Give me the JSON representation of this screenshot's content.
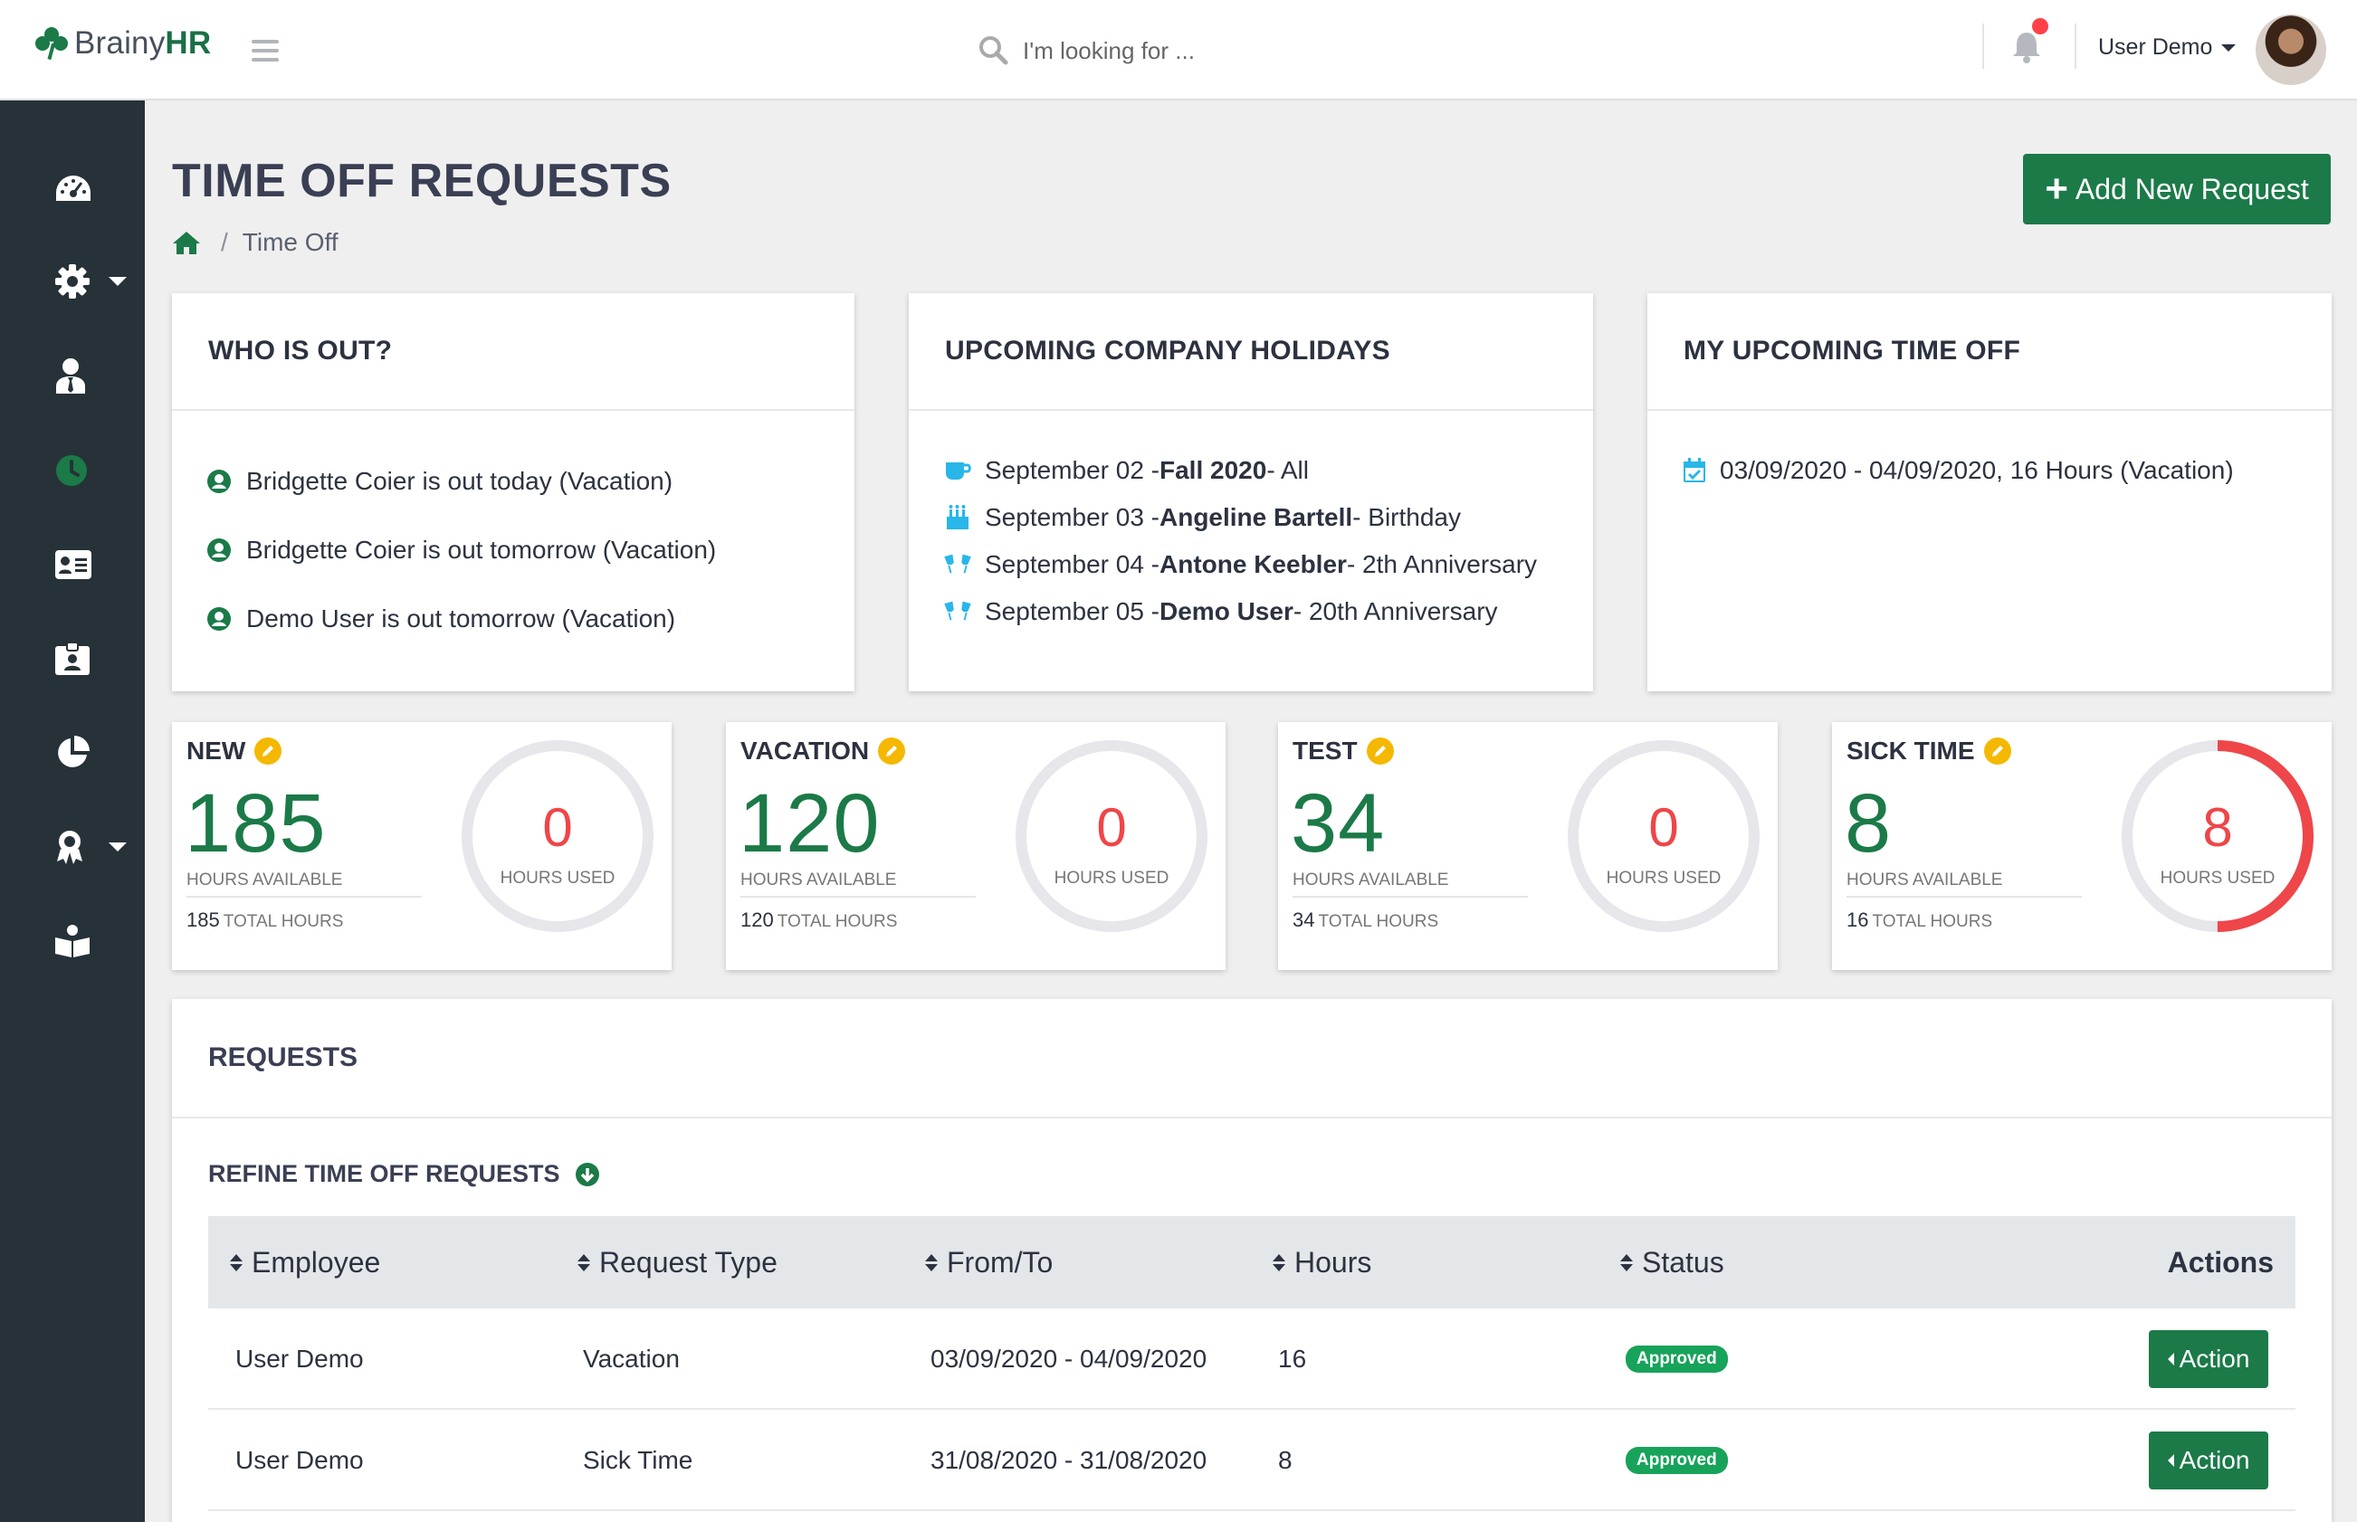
{
  "brand": {
    "name_prefix": "Brainy",
    "name_bold": "HR"
  },
  "search": {
    "placeholder": "I'm looking for ..."
  },
  "user": {
    "name": "User Demo"
  },
  "page": {
    "title": "TIME OFF REQUESTS",
    "breadcrumb_current": "Time Off",
    "breadcrumb_sep": "/",
    "add_button": "Add New Request"
  },
  "who_is_out": {
    "title": "WHO IS OUT?",
    "items": [
      "Bridgette Coier is out today (Vacation)",
      "Bridgette Coier is out tomorrow (Vacation)",
      "Demo User is out tomorrow (Vacation)"
    ]
  },
  "holidays": {
    "title": "UPCOMING COMPANY HOLIDAYS",
    "items": [
      {
        "icon": "coffee-icon",
        "date": "September 02 - ",
        "name": "Fall 2020",
        "suffix": " - All"
      },
      {
        "icon": "birthday-cake-icon",
        "date": "September 03 - ",
        "name": "Angeline Bartell",
        "suffix": " - Birthday"
      },
      {
        "icon": "glasses-cheers-icon",
        "date": "September 04 - ",
        "name": "Antone Keebler",
        "suffix": " - 2th Anniversary"
      },
      {
        "icon": "glasses-cheers-icon",
        "date": "September 05 - ",
        "name": "Demo User",
        "suffix": " - 20th Anniversary"
      }
    ]
  },
  "my_time_off": {
    "title": "MY UPCOMING TIME OFF",
    "items": [
      "03/09/2020 - 04/09/2020, 16 Hours (Vacation)"
    ]
  },
  "stats": [
    {
      "title": "NEW",
      "available": "185",
      "available_label": "HOURS AVAILABLE",
      "total": "185",
      "total_label": "TOTAL HOURS",
      "used": "0",
      "used_label": "HOURS USED",
      "used_fraction": 0
    },
    {
      "title": "VACATION",
      "available": "120",
      "available_label": "HOURS AVAILABLE",
      "total": "120",
      "total_label": "TOTAL HOURS",
      "used": "0",
      "used_label": "HOURS USED",
      "used_fraction": 0
    },
    {
      "title": "TEST",
      "available": "34",
      "available_label": "HOURS AVAILABLE",
      "total": "34",
      "total_label": "TOTAL HOURS",
      "used": "0",
      "used_label": "HOURS USED",
      "used_fraction": 0
    },
    {
      "title": "SICK TIME",
      "available": "8",
      "available_label": "HOURS AVAILABLE",
      "total": "16",
      "total_label": "TOTAL HOURS",
      "used": "8",
      "used_label": "HOURS USED",
      "used_fraction": 0.5
    }
  ],
  "requests": {
    "title": "REQUESTS",
    "refine_label": "REFINE TIME OFF REQUESTS",
    "columns": [
      "Employee",
      "Request Type",
      "From/To",
      "Hours",
      "Status",
      "Actions"
    ],
    "rows": [
      {
        "employee": "User Demo",
        "type": "Vacation",
        "range": "03/09/2020 - 04/09/2020",
        "hours": "16",
        "status": "Approved",
        "action": "Action"
      },
      {
        "employee": "User Demo",
        "type": "Sick Time",
        "range": "31/08/2020 - 31/08/2020",
        "hours": "8",
        "status": "Approved",
        "action": "Action"
      }
    ]
  },
  "colors": {
    "primary": "#1b7a48",
    "sidebar": "#263238",
    "danger": "#ee4649",
    "warning": "#f5b800"
  }
}
